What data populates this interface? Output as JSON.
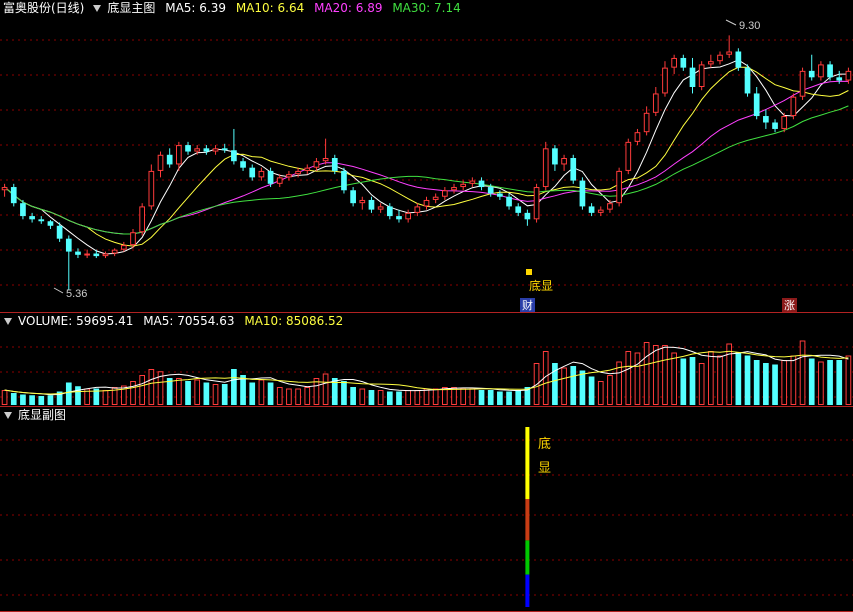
{
  "main_header": {
    "stock_name": "富奥股份(日线)",
    "indicator_name": "底显主图",
    "ma5": "MA5: 6.39",
    "ma10": "MA10: 6.64",
    "ma20": "MA20: 6.89",
    "ma30": "MA30: 7.14"
  },
  "volume_header": {
    "volume": "VOLUME: 59695.41",
    "ma5": "MA5: 70554.63",
    "ma10": "MA10: 85086.52"
  },
  "sub_header": {
    "indicator_name": "底显副图"
  },
  "annotations": {
    "max_label": "9.30",
    "min_label": "5.36",
    "signal_label": "底显",
    "badge_fin": "财",
    "badge_up": "涨",
    "sub_signal_char1": "底",
    "sub_signal_char2": "显"
  },
  "colors": {
    "background": "#000000",
    "grid": "#8b0000",
    "up": "#ff3b3b",
    "down": "#54ffff",
    "ma5": "#ffffff",
    "ma10": "#ffff40",
    "ma20": "#ff40ff",
    "ma30": "#40e040",
    "label_yellow": "#ffd700"
  },
  "chart_data": [
    {
      "type": "candlestick",
      "title": "富奥股份(日线)",
      "min_price": 5.36,
      "max_price": 9.3,
      "ylim": [
        5.2,
        9.6
      ],
      "grid": true,
      "signal_index": 57,
      "ohlc": [
        [
          6.9,
          7.0,
          6.8,
          6.95
        ],
        [
          6.95,
          7.0,
          6.65,
          6.7
        ],
        [
          6.7,
          6.75,
          6.45,
          6.5
        ],
        [
          6.5,
          6.55,
          6.4,
          6.45
        ],
        [
          6.45,
          6.5,
          6.38,
          6.42
        ],
        [
          6.42,
          6.44,
          6.3,
          6.35
        ],
        [
          6.35,
          6.4,
          6.1,
          6.15
        ],
        [
          6.15,
          6.2,
          5.36,
          5.95
        ],
        [
          5.95,
          6.0,
          5.85,
          5.9
        ],
        [
          5.9,
          5.98,
          5.85,
          5.92
        ],
        [
          5.92,
          5.98,
          5.85,
          5.88
        ],
        [
          5.88,
          5.95,
          5.85,
          5.92
        ],
        [
          5.92,
          6.0,
          5.88,
          5.98
        ],
        [
          5.98,
          6.1,
          5.95,
          6.05
        ],
        [
          6.05,
          6.3,
          6.0,
          6.25
        ],
        [
          6.25,
          6.7,
          6.2,
          6.65
        ],
        [
          6.65,
          7.3,
          6.6,
          7.2
        ],
        [
          7.2,
          7.5,
          7.1,
          7.45
        ],
        [
          7.45,
          7.55,
          7.25,
          7.3
        ],
        [
          7.3,
          7.65,
          7.2,
          7.6
        ],
        [
          7.6,
          7.65,
          7.45,
          7.5
        ],
        [
          7.5,
          7.6,
          7.45,
          7.55
        ],
        [
          7.55,
          7.6,
          7.45,
          7.5
        ],
        [
          7.5,
          7.6,
          7.45,
          7.55
        ],
        [
          7.55,
          7.62,
          7.48,
          7.52
        ],
        [
          7.52,
          7.85,
          7.3,
          7.35
        ],
        [
          7.35,
          7.4,
          7.2,
          7.25
        ],
        [
          7.25,
          7.3,
          7.05,
          7.1
        ],
        [
          7.1,
          7.25,
          7.05,
          7.2
        ],
        [
          7.2,
          7.25,
          6.95,
          7.0
        ],
        [
          7.0,
          7.15,
          6.95,
          7.1
        ],
        [
          7.1,
          7.2,
          7.05,
          7.15
        ],
        [
          7.15,
          7.25,
          7.1,
          7.2
        ],
        [
          7.2,
          7.3,
          7.15,
          7.25
        ],
        [
          7.25,
          7.4,
          7.2,
          7.35
        ],
        [
          7.35,
          7.7,
          7.3,
          7.4
        ],
        [
          7.4,
          7.45,
          7.15,
          7.2
        ],
        [
          7.2,
          7.25,
          6.85,
          6.9
        ],
        [
          6.9,
          6.95,
          6.65,
          6.7
        ],
        [
          6.7,
          6.8,
          6.6,
          6.75
        ],
        [
          6.75,
          6.8,
          6.55,
          6.6
        ],
        [
          6.6,
          6.7,
          6.55,
          6.65
        ],
        [
          6.65,
          6.7,
          6.45,
          6.5
        ],
        [
          6.5,
          6.6,
          6.4,
          6.45
        ],
        [
          6.45,
          6.6,
          6.4,
          6.55
        ],
        [
          6.55,
          6.7,
          6.5,
          6.65
        ],
        [
          6.65,
          6.8,
          6.6,
          6.75
        ],
        [
          6.75,
          6.85,
          6.7,
          6.8
        ],
        [
          6.8,
          6.95,
          6.75,
          6.9
        ],
        [
          6.9,
          7.0,
          6.85,
          6.95
        ],
        [
          6.95,
          7.05,
          6.9,
          7.0
        ],
        [
          7.0,
          7.1,
          6.95,
          7.05
        ],
        [
          7.05,
          7.1,
          6.9,
          6.95
        ],
        [
          6.95,
          7.0,
          6.8,
          6.85
        ],
        [
          6.85,
          6.9,
          6.75,
          6.8
        ],
        [
          6.8,
          6.85,
          6.6,
          6.65
        ],
        [
          6.65,
          6.7,
          6.5,
          6.55
        ],
        [
          6.55,
          6.6,
          6.35,
          6.45
        ],
        [
          6.45,
          7.0,
          6.4,
          6.95
        ],
        [
          6.95,
          7.65,
          6.9,
          7.55
        ],
        [
          7.55,
          7.6,
          7.2,
          7.3
        ],
        [
          7.3,
          7.45,
          7.2,
          7.4
        ],
        [
          7.4,
          7.45,
          7.0,
          7.05
        ],
        [
          7.05,
          7.1,
          6.6,
          6.65
        ],
        [
          6.65,
          6.7,
          6.5,
          6.55
        ],
        [
          6.55,
          6.65,
          6.5,
          6.6
        ],
        [
          6.6,
          6.75,
          6.55,
          6.7
        ],
        [
          6.7,
          7.25,
          6.65,
          7.2
        ],
        [
          7.2,
          7.7,
          7.15,
          7.65
        ],
        [
          7.65,
          7.85,
          7.6,
          7.8
        ],
        [
          7.8,
          8.2,
          7.75,
          8.1
        ],
        [
          8.1,
          8.5,
          8.05,
          8.4
        ],
        [
          8.4,
          8.9,
          8.35,
          8.8
        ],
        [
          8.8,
          9.0,
          8.7,
          8.95
        ],
        [
          8.95,
          9.0,
          8.75,
          8.8
        ],
        [
          8.8,
          8.95,
          8.4,
          8.5
        ],
        [
          8.5,
          8.9,
          8.45,
          8.85
        ],
        [
          8.85,
          9.0,
          8.8,
          8.9
        ],
        [
          8.9,
          9.05,
          8.85,
          9.0
        ],
        [
          9.0,
          9.3,
          8.95,
          9.05
        ],
        [
          9.05,
          9.1,
          8.75,
          8.8
        ],
        [
          8.8,
          8.85,
          8.35,
          8.4
        ],
        [
          8.4,
          8.5,
          8.0,
          8.05
        ],
        [
          8.05,
          8.15,
          7.85,
          7.95
        ],
        [
          7.95,
          8.0,
          7.8,
          7.85
        ],
        [
          7.85,
          8.1,
          7.8,
          8.05
        ],
        [
          8.05,
          8.4,
          8.0,
          8.35
        ],
        [
          8.35,
          8.8,
          8.3,
          8.75
        ],
        [
          8.75,
          9.0,
          8.6,
          8.65
        ],
        [
          8.65,
          8.9,
          8.6,
          8.85
        ],
        [
          8.85,
          8.9,
          8.6,
          8.65
        ],
        [
          8.65,
          8.75,
          8.55,
          8.6
        ],
        [
          8.6,
          8.8,
          8.55,
          8.75
        ]
      ]
    },
    {
      "type": "bar",
      "title": "VOLUME",
      "values": [
        20,
        16,
        14,
        13,
        12,
        13,
        18,
        30,
        25,
        22,
        22,
        20,
        24,
        26,
        32,
        40,
        48,
        45,
        36,
        36,
        32,
        34,
        30,
        28,
        28,
        48,
        40,
        30,
        34,
        30,
        24,
        22,
        22,
        24,
        36,
        42,
        36,
        32,
        24,
        22,
        20,
        20,
        18,
        18,
        20,
        20,
        22,
        22,
        24,
        24,
        22,
        22,
        20,
        20,
        18,
        18,
        20,
        24,
        56,
        72,
        56,
        50,
        52,
        46,
        38,
        32,
        40,
        58,
        72,
        70,
        84,
        80,
        80,
        70,
        62,
        64,
        56,
        72,
        66,
        82,
        70,
        66,
        60,
        56,
        54,
        60,
        66,
        86,
        62,
        58,
        60,
        60,
        66
      ],
      "ylim": [
        0,
        100
      ],
      "grid": true
    },
    {
      "type": "bar",
      "title": "底显副图",
      "signal_index": 57,
      "segment_colors": [
        "#ffff00",
        "#c83c14",
        "#00c800",
        "#0000ff"
      ],
      "grid": true
    }
  ]
}
